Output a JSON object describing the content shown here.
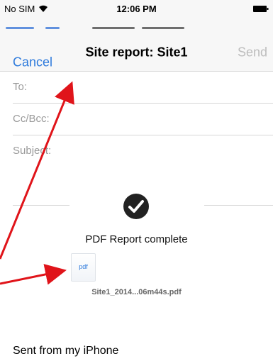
{
  "status_bar": {
    "carrier": "No SIM",
    "time": "12:06 PM"
  },
  "nav": {
    "cancel_label": "Cancel",
    "title": "Site report: Site1",
    "send_label": "Send"
  },
  "fields": {
    "to_label": "To:",
    "cc_bcc_label": "Cc/Bcc:",
    "subject_label": "Subject:"
  },
  "hud": {
    "message": "PDF Report complete"
  },
  "attachment": {
    "icon_text": "pdf",
    "filename": "Site1_2014...06m44s.pdf"
  },
  "body": {
    "signature": "Sent from my iPhone"
  },
  "icons": {
    "wifi": "wifi-icon",
    "battery": "battery-icon",
    "checkmark": "checkmark-icon",
    "attachment": "pdf-document-icon",
    "annotation_arrow": "red-arrow-icon"
  },
  "colors": {
    "accent": "#2f7bdc",
    "disabled": "#bdbdbd",
    "annotation": "#e0141a"
  }
}
